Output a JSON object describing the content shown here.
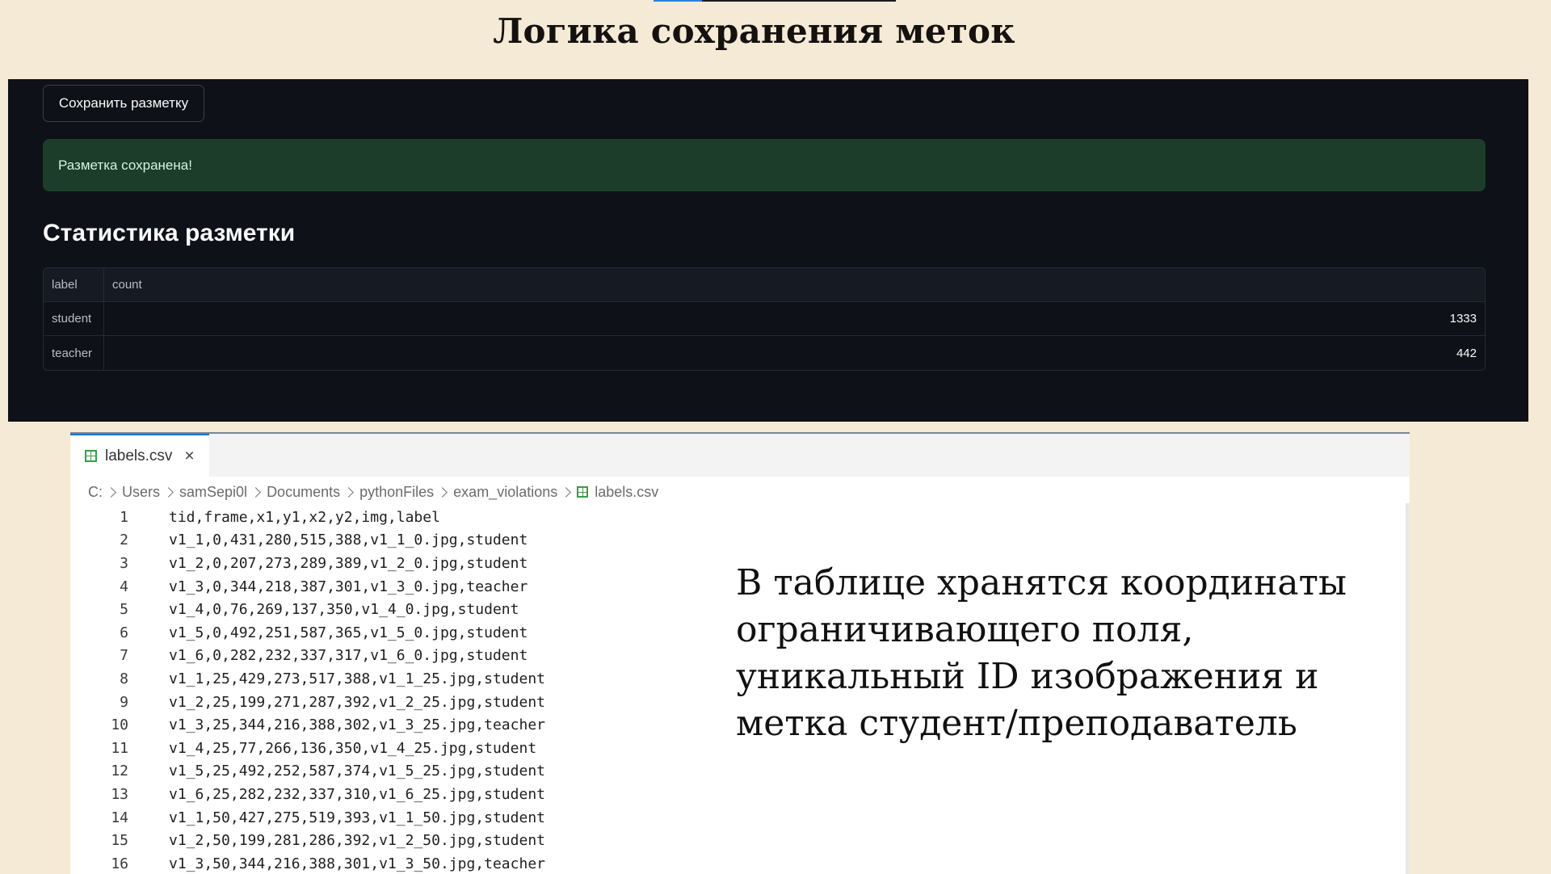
{
  "slide": {
    "title": "Логика сохранения меток",
    "description": "В таблице хранятся координаты ограничивающего поля, уникальный ID изображения и метка студент/преподаватель"
  },
  "app": {
    "save_button_label": "Сохранить разметку",
    "success_message": "Разметка сохранена!",
    "stats_heading": "Статистика разметки",
    "table": {
      "columns": [
        "label",
        "count"
      ],
      "rows": [
        {
          "label": "student",
          "count": "1333"
        },
        {
          "label": "teacher",
          "count": "442"
        }
      ]
    }
  },
  "editor": {
    "tab_label": "labels.csv",
    "breadcrumb": [
      "C:",
      "Users",
      "samSepi0l",
      "Documents",
      "pythonFiles",
      "exam_violations",
      "labels.csv"
    ],
    "lines": [
      {
        "no": "1",
        "text": "tid,frame,x1,y1,x2,y2,img,label"
      },
      {
        "no": "2",
        "text": "v1_1,0,431,280,515,388,v1_1_0.jpg,student"
      },
      {
        "no": "3",
        "text": "v1_2,0,207,273,289,389,v1_2_0.jpg,student"
      },
      {
        "no": "4",
        "text": "v1_3,0,344,218,387,301,v1_3_0.jpg,teacher"
      },
      {
        "no": "5",
        "text": "v1_4,0,76,269,137,350,v1_4_0.jpg,student"
      },
      {
        "no": "6",
        "text": "v1_5,0,492,251,587,365,v1_5_0.jpg,student"
      },
      {
        "no": "7",
        "text": "v1_6,0,282,232,337,317,v1_6_0.jpg,student"
      },
      {
        "no": "8",
        "text": "v1_1,25,429,273,517,388,v1_1_25.jpg,student"
      },
      {
        "no": "9",
        "text": "v1_2,25,199,271,287,392,v1_2_25.jpg,student"
      },
      {
        "no": "10",
        "text": "v1_3,25,344,216,388,302,v1_3_25.jpg,teacher"
      },
      {
        "no": "11",
        "text": "v1_4,25,77,266,136,350,v1_4_25.jpg,student"
      },
      {
        "no": "12",
        "text": "v1_5,25,492,252,587,374,v1_5_25.jpg,student"
      },
      {
        "no": "13",
        "text": "v1_6,25,282,232,337,310,v1_6_25.jpg,student"
      },
      {
        "no": "14",
        "text": "v1_1,50,427,275,519,393,v1_1_50.jpg,student"
      },
      {
        "no": "15",
        "text": "v1_2,50,199,281,286,392,v1_2_50.jpg,student"
      },
      {
        "no": "16",
        "text": "v1_3,50,344,216,388,301,v1_3_50.jpg,teacher"
      }
    ]
  },
  "colors": {
    "slide_background": "#f5ead6",
    "dark_panel": "#0e1117",
    "success_background": "#1b3d2a",
    "tab_accent": "#1e73c8",
    "csv_icon": "#3c9a4a"
  }
}
